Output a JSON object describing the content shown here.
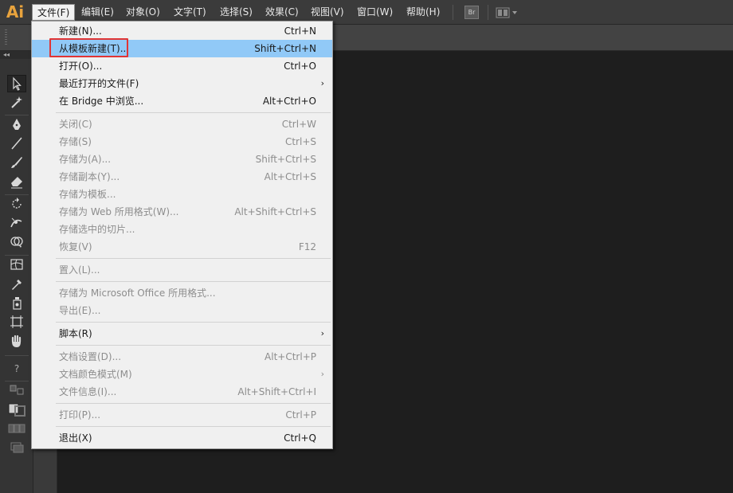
{
  "app": {
    "logo": "Ai"
  },
  "menubar": {
    "items": [
      {
        "label": "文件(F)"
      },
      {
        "label": "编辑(E)"
      },
      {
        "label": "对象(O)"
      },
      {
        "label": "文字(T)"
      },
      {
        "label": "选择(S)"
      },
      {
        "label": "效果(C)"
      },
      {
        "label": "视图(V)"
      },
      {
        "label": "窗口(W)"
      },
      {
        "label": "帮助(H)"
      }
    ],
    "bridge_button": "Br"
  },
  "toolbar": {
    "collapse": "◂◂",
    "help_glyph": "?"
  },
  "file_menu": {
    "items": [
      {
        "label": "新建(N)...",
        "shortcut": "Ctrl+N"
      },
      {
        "label": "从模板新建(T)...",
        "shortcut": "Shift+Ctrl+N"
      },
      {
        "label": "打开(O)...",
        "shortcut": "Ctrl+O"
      },
      {
        "label": "最近打开的文件(F)",
        "arrow": "›"
      },
      {
        "label": "在 Bridge 中浏览...",
        "shortcut": "Alt+Ctrl+O"
      },
      {
        "label": "关闭(C)",
        "shortcut": "Ctrl+W"
      },
      {
        "label": "存储(S)",
        "shortcut": "Ctrl+S"
      },
      {
        "label": "存储为(A)...",
        "shortcut": "Shift+Ctrl+S"
      },
      {
        "label": "存储副本(Y)...",
        "shortcut": "Alt+Ctrl+S"
      },
      {
        "label": "存储为模板..."
      },
      {
        "label": "存储为 Web 所用格式(W)...",
        "shortcut": "Alt+Shift+Ctrl+S"
      },
      {
        "label": "存储选中的切片..."
      },
      {
        "label": "恢复(V)",
        "shortcut": "F12"
      },
      {
        "label": "置入(L)..."
      },
      {
        "label": "存储为 Microsoft Office 所用格式..."
      },
      {
        "label": "导出(E)..."
      },
      {
        "label": "脚本(R)",
        "arrow": "›"
      },
      {
        "label": "文档设置(D)...",
        "shortcut": "Alt+Ctrl+P"
      },
      {
        "label": "文档颜色模式(M)",
        "arrow": "›"
      },
      {
        "label": "文件信息(I)...",
        "shortcut": "Alt+Shift+Ctrl+I"
      },
      {
        "label": "打印(P)...",
        "shortcut": "Ctrl+P"
      },
      {
        "label": "退出(X)",
        "shortcut": "Ctrl+Q"
      }
    ]
  },
  "colors": {
    "highlight": "#91c9f7",
    "annotation_box": "#e03535",
    "logo": "#e8a33d"
  }
}
